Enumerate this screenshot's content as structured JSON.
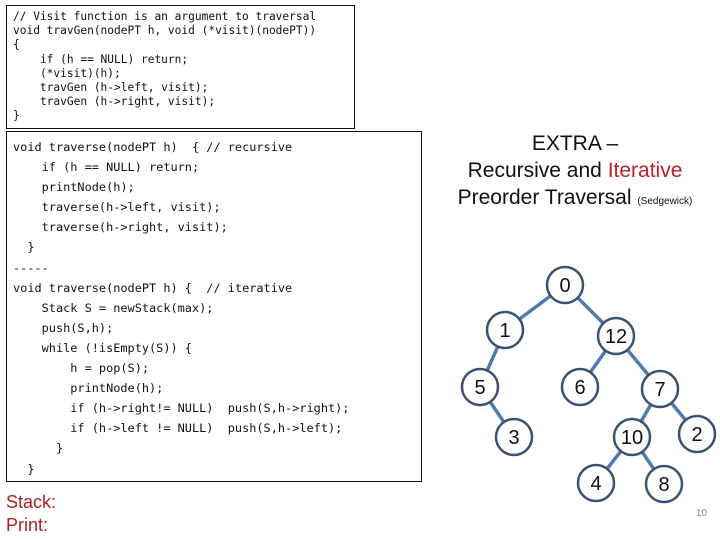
{
  "generic_code": {
    "lines": [
      "// Visit function is an argument to traversal",
      "void travGen(nodePT h, void (*visit)(nodePT))",
      "{",
      "    if (h == NULL) return;",
      "    (*visit)(h);",
      "    travGen (h->left, visit);",
      "    travGen (h->right, visit);",
      "}"
    ]
  },
  "traverse_code": {
    "lines": [
      "void traverse(nodePT h)  { // recursive",
      "    if (h == NULL) return;",
      "    printNode(h);",
      "    traverse(h->left, visit);",
      "    traverse(h->right, visit);",
      "  }",
      "-----",
      "void traverse(nodePT h) {  // iterative",
      "    Stack S = newStack(max);",
      "    push(S,h);",
      "    while (!isEmpty(S)) {",
      "        h = pop(S);",
      "        printNode(h);",
      "        if (h->right!= NULL)  push(S,h->right);",
      "        if (h->left != NULL)  push(S,h->left);",
      "      }",
      "  }"
    ]
  },
  "labels": {
    "stack": "Stack:",
    "print": "Print:"
  },
  "title": {
    "line1": "EXTRA –",
    "line2_plain": "Recursive and ",
    "line2_highlight": "Iterative",
    "line3_main": "Preorder Traversal ",
    "line3_small": "(Sedgewick)"
  },
  "colors": {
    "highlight": "#c0202a",
    "node_outline": "#3d5273",
    "edge": "#4f7bb0"
  },
  "tree": {
    "nodes": [
      {
        "id": "0",
        "label": "0"
      },
      {
        "id": "1",
        "label": "1"
      },
      {
        "id": "12",
        "label": "12"
      },
      {
        "id": "5",
        "label": "5"
      },
      {
        "id": "6",
        "label": "6"
      },
      {
        "id": "7",
        "label": "7"
      },
      {
        "id": "3",
        "label": "3"
      },
      {
        "id": "10",
        "label": "10"
      },
      {
        "id": "2",
        "label": "2"
      },
      {
        "id": "4",
        "label": "4"
      },
      {
        "id": "8",
        "label": "8"
      }
    ],
    "edges": [
      [
        "0",
        "1"
      ],
      [
        "0",
        "12"
      ],
      [
        "1",
        "5"
      ],
      [
        "5",
        "3"
      ],
      [
        "12",
        "6"
      ],
      [
        "12",
        "7"
      ],
      [
        "7",
        "10"
      ],
      [
        "7",
        "2"
      ],
      [
        "10",
        "4"
      ],
      [
        "10",
        "8"
      ]
    ]
  },
  "page_number": "10"
}
